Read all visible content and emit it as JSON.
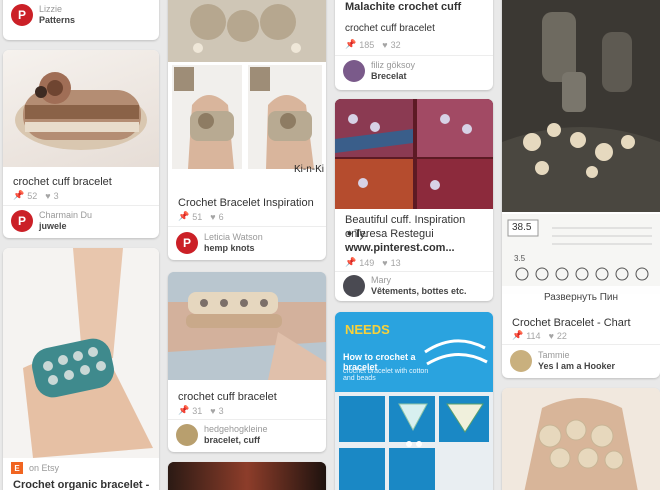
{
  "icons": {
    "repin": "pushpin-icon",
    "like": "heart-icon",
    "pin_badge": "P",
    "etsy_badge": "E"
  },
  "colors": {
    "background": "#e9e9e9",
    "pin_red": "#cb2027",
    "text": "#333333",
    "muted": "#a5a5a5"
  },
  "col1": {
    "card1": {
      "user": "Lizzie",
      "board": "Patterns"
    },
    "card2": {
      "title": "crochet cuff bracelet",
      "repins": "52",
      "likes": "3",
      "user": "Charmain Du",
      "board": "juwele"
    },
    "card3": {
      "source": "on Etsy",
      "title": "Crochet organic bracelet -"
    }
  },
  "col2": {
    "card1": {
      "caption": "Ki-n-Ki",
      "title": "Crochet Bracelet Inspiration",
      "repins": "51",
      "likes": "6",
      "user": "Leticia Watson",
      "board": "hemp knots"
    },
    "card2": {
      "title": "crochet cuff bracelet",
      "repins": "31",
      "likes": "3",
      "user": "hedgehogkleine",
      "board": "bracelet, cuff"
    }
  },
  "col3": {
    "card1": {
      "header": "Malachite crochet cuff",
      "title": "crochet cuff bracelet",
      "repins": "185",
      "likes": "32",
      "user": "filiz göksoy",
      "board": "Brecelat"
    },
    "card2": {
      "title_line1": "Beautiful cuff. Inspiration only.",
      "title_line2": "➧Teresa Restegui",
      "title_line3": "www.pinterest.com...",
      "repins": "149",
      "likes": "13",
      "user": "Mary",
      "board": "Vêtements, bottes etc."
    },
    "card3": {
      "brand": "NEEDS",
      "heading": "How to crochet a bracelet",
      "subheading": "crochet bracelet with cotton and beads"
    }
  },
  "col4": {
    "card1": {
      "chart_code": "38.5",
      "chart_label": "3.5",
      "expand": "Развернуть Пин",
      "title": "Crochet Bracelet - Chart",
      "repins": "114",
      "likes": "22",
      "user": "Tammie",
      "board": "Yes I am a Hooker"
    }
  }
}
